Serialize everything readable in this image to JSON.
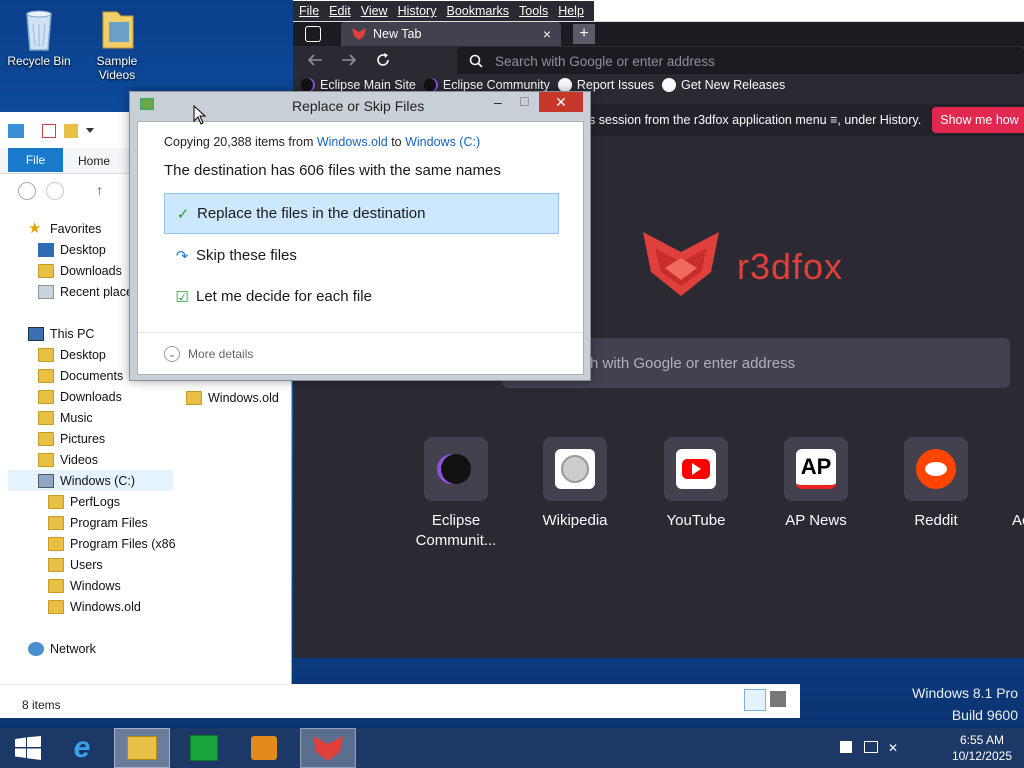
{
  "desktop": {
    "icons": [
      {
        "label": "Recycle Bin"
      },
      {
        "label": "Sample Videos"
      }
    ],
    "watermark": {
      "line1": "Windows 8.1 Pro",
      "line2": "Build 9600"
    }
  },
  "firefox": {
    "menu": [
      "File",
      "Edit",
      "View",
      "History",
      "Bookmarks",
      "Tools",
      "Help"
    ],
    "tab": {
      "title": "New Tab",
      "close": "×"
    },
    "new_tab_glyph": "+",
    "url_placeholder": "Search with Google or enter address",
    "bookmarks": [
      "Eclipse Main Site",
      "Eclipse Community",
      "Report Issues",
      "Get New Releases"
    ],
    "notice": {
      "text": "s session from the r3dfox application menu ≡, under History.",
      "button": "Show me how"
    },
    "brand": "r3dfox",
    "search_placeholder": "h with Google or enter address",
    "top_sites": [
      {
        "label": "Eclipse Communit...",
        "icon": "eclipse-icon"
      },
      {
        "label": "Wikipedia",
        "icon": "wikipedia-icon"
      },
      {
        "label": "YouTube",
        "icon": "youtube-icon"
      },
      {
        "label": "AP News",
        "icon": "ap-news-icon"
      },
      {
        "label": "Reddit",
        "icon": "reddit-icon"
      },
      {
        "label": "Ac",
        "icon": "partial-icon"
      }
    ],
    "colors": {
      "bg": "#2b2a33",
      "accent": "#e0403b",
      "button": "#e22850"
    }
  },
  "explorer": {
    "ribbon": {
      "file": "File",
      "home": "Home"
    },
    "nav": {
      "favorites": "Favorites",
      "fav_items": [
        "Desktop",
        "Downloads",
        "Recent places"
      ],
      "this_pc": "This PC",
      "pc_items": [
        "Desktop",
        "Documents",
        "Downloads",
        "Music",
        "Pictures",
        "Videos",
        "Windows (C:)"
      ],
      "c_items": [
        "PerfLogs",
        "Program Files",
        "Program Files (x86",
        "Users",
        "Windows",
        "Windows.old"
      ],
      "network": "Network"
    },
    "content_item": "Windows.old",
    "status": "8 items"
  },
  "dialog": {
    "title": "Replace or Skip Files",
    "copy_prefix": "Copying 20,388 items from ",
    "source": "Windows.old",
    "copy_mid": " to ",
    "dest": "Windows (C:)",
    "heading": "The destination has 606 files with the same names",
    "options": [
      {
        "label": "Replace the files in the destination",
        "icon": "check-icon"
      },
      {
        "label": "Skip these files",
        "icon": "skip-icon"
      },
      {
        "label": "Let me decide for each file",
        "icon": "decide-icon"
      }
    ],
    "more_details": "More details",
    "close_glyph": "✕",
    "min_glyph": "–",
    "max_glyph": "□"
  },
  "taskbar": {
    "time": "6:55 AM",
    "date": "10/12/2025"
  }
}
